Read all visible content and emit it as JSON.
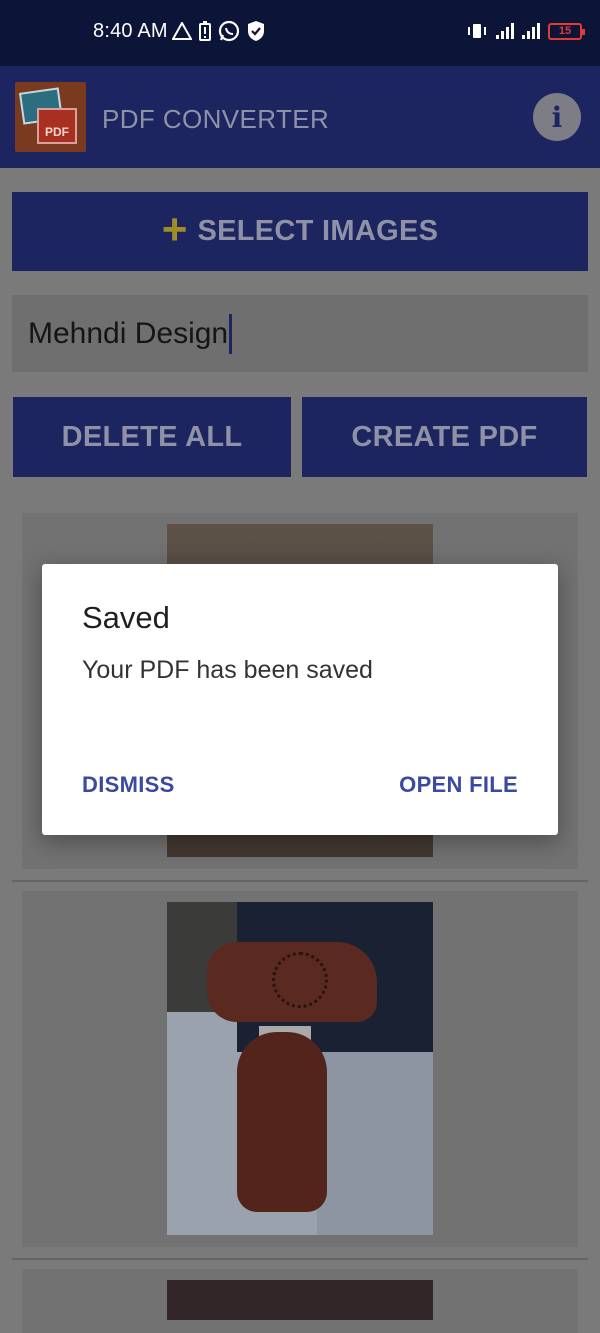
{
  "status_bar": {
    "time": "8:40 AM",
    "battery": "15"
  },
  "app_bar": {
    "title": "PDF CONVERTER",
    "logo_text": "PDF",
    "info_icon": "info-icon"
  },
  "actions": {
    "select_images_label": "SELECT IMAGES",
    "pdf_name_value": "Mehndi Design",
    "delete_all_label": "DELETE ALL",
    "create_pdf_label": "CREATE PDF"
  },
  "dialog": {
    "title": "Saved",
    "message": "Your PDF has been saved",
    "dismiss_label": "DISMISS",
    "open_file_label": "OPEN FILE"
  },
  "colors": {
    "primary": "#1c2560",
    "accent": "#a08d2a",
    "dialog_button": "#3b4aa0"
  }
}
